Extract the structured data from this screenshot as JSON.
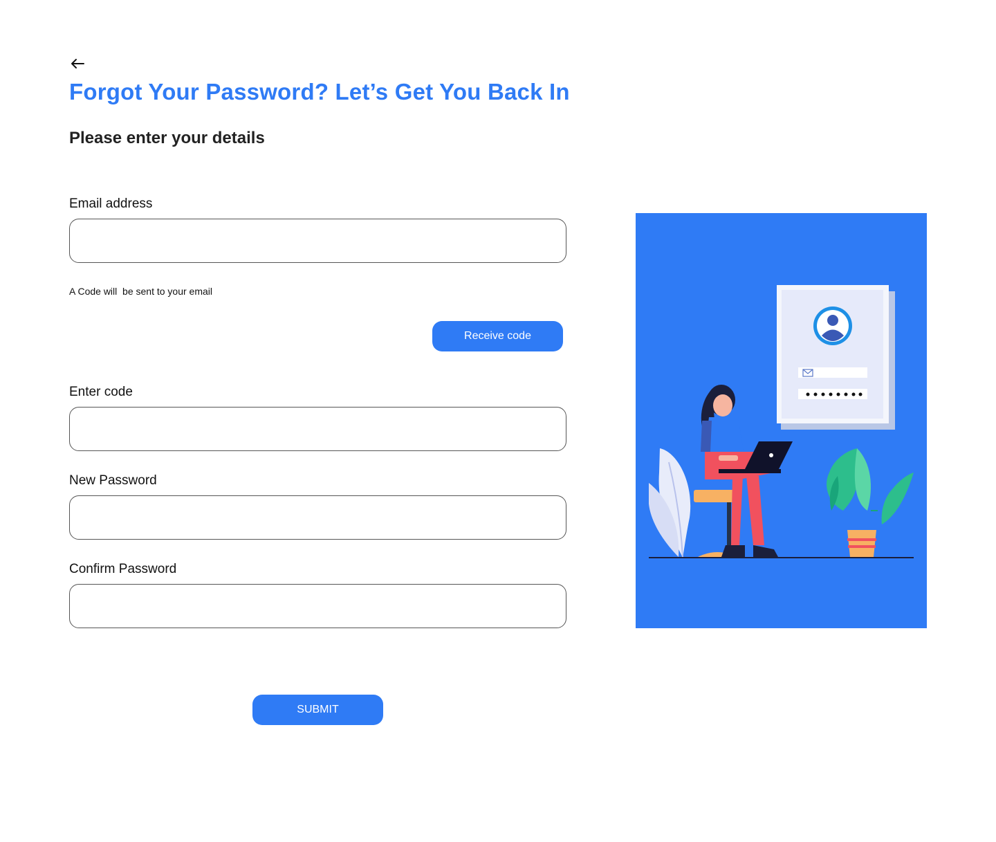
{
  "header": {
    "title": "Forgot Your Password? Let’s Get You Back In",
    "subtitle": "Please enter your details"
  },
  "form": {
    "email": {
      "label": "Email address",
      "value": "",
      "hint": "A Code will  be sent to your email"
    },
    "receive_code_label": "Receive code",
    "code": {
      "label": "Enter code",
      "value": ""
    },
    "new_password": {
      "label": "New Password",
      "value": ""
    },
    "confirm_password": {
      "label": "Confirm Password",
      "value": ""
    },
    "submit_label": "SUBMIT"
  },
  "icons": {
    "back": "arrow-left-icon"
  },
  "colors": {
    "accent": "#2F7BF5",
    "illustration_bg": "#2F7BF5"
  }
}
